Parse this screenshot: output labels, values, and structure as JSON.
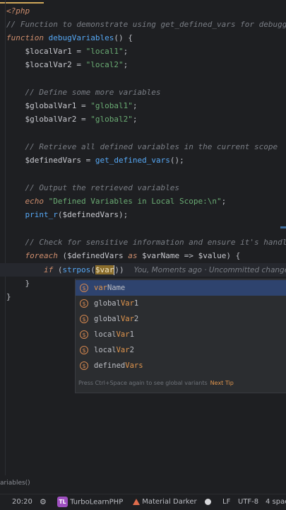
{
  "editor": {
    "lines": {
      "php_open": "<?php",
      "comment1": "// Function to demonstrate using get_defined_vars for debugging",
      "fn_kw": "function",
      "fn_name": "debugVariables",
      "fn_tail": "() {",
      "l1_var": "$localVar1",
      "l1_str": "\"local1\"",
      "l2_var": "$localVar2",
      "l2_str": "\"local2\"",
      "comment2": "// Define some more variables",
      "g1_var": "$globalVar1",
      "g1_str": "\"global1\"",
      "g2_var": "$globalVar2",
      "g2_str": "\"global2\"",
      "comment3": "// Retrieve all defined variables in the current scope",
      "dv_var": "$definedVars",
      "dv_fn": "get_defined_vars",
      "comment4": "// Output the retrieved variables",
      "echo_kw": "echo",
      "echo_str": "\"Defined Variables in Local Scope:\\n\"",
      "print_fn": "print_r",
      "print_arg": "$definedVars",
      "comment5": "// Check for sensitive information and ensure it's handled safe",
      "foreach_kw": "foreach",
      "foreach_var": "$definedVars",
      "as_kw": "as",
      "fe_key": "$varName",
      "fe_val": "$value",
      "if_kw": "if",
      "strpos_fn": "strpos",
      "typed": "$var",
      "close_inner": "}",
      "close_outer": "}"
    },
    "blame_inlay": "You, Moments ago · Uncommitted changes"
  },
  "completion": {
    "items": [
      {
        "match": "var",
        "rest_before": "",
        "rest_after": "Name",
        "selected": true
      },
      {
        "match": "Var",
        "rest_before": "global",
        "rest_after": "1",
        "selected": false
      },
      {
        "match": "Var",
        "rest_before": "global",
        "rest_after": "2",
        "selected": false
      },
      {
        "match": "Var",
        "rest_before": "local",
        "rest_after": "1",
        "selected": false
      },
      {
        "match": "Var",
        "rest_before": "local",
        "rest_after": "2",
        "selected": false
      },
      {
        "match": "Vars",
        "rest_before": "defined",
        "rest_after": "",
        "selected": false
      }
    ],
    "icon_glyph": "$",
    "footer_hint": "Press Ctrl+Space again to see global variants",
    "footer_tip": "Next Tip"
  },
  "breadcrumb": "ariables()",
  "statusbar": {
    "position": "20:20",
    "plugin_badge": "TL",
    "plugin_name": "TurboLearnPHP",
    "theme": "Material Darker",
    "line_ending": "LF",
    "encoding": "UTF-8",
    "indent": "4 spac"
  },
  "colors": {
    "background": "#1e1f22",
    "keyword": "#cf8e6d",
    "function": "#56a8f5",
    "string": "#6aab73",
    "comment": "#7a7e85",
    "selection": "#2e436e",
    "match": "#e0954d"
  }
}
